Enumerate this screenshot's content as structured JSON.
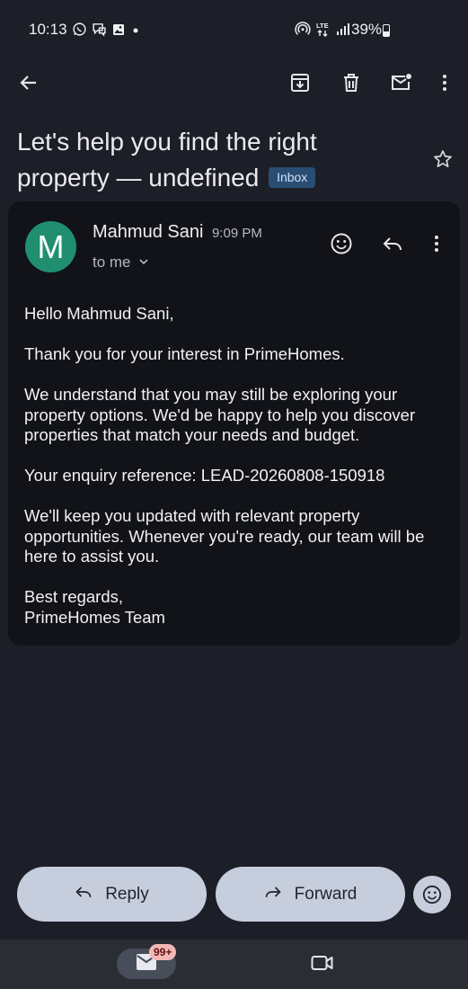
{
  "status_bar": {
    "time": "10:13",
    "battery": "39%",
    "left_icons": [
      "whatsapp-icon",
      "messenger-icon",
      "gallery-icon",
      "dot-icon"
    ],
    "right_icons": [
      "hotspot-icon",
      "lte-icon",
      "signal-icon",
      "battery-icon"
    ]
  },
  "toolbar": {
    "icons": [
      "back-arrow-icon",
      "archive-icon",
      "delete-icon",
      "mark-unread-icon",
      "more-vert-icon"
    ]
  },
  "email": {
    "subject": "Let's help you find the right property — undefined",
    "label_chip": "Inbox",
    "sender_initial": "M",
    "sender_name": "Mahmud Sani",
    "sent_time": "9:09 PM",
    "recipient": "to me",
    "body": [
      "Hello Mahmud Sani,",
      "Thank you for your interest in PrimeHomes.",
      "We understand that you may still be exploring your property options. We'd be happy to help you discover properties that match your needs and budget.",
      "Your enquiry reference: LEAD-20260808-150918",
      "We'll keep you updated with relevant property opportunities. Whenever you're ready, our team will be here to assist you.",
      "Best regards,",
      "PrimeHomes Team"
    ]
  },
  "actions": {
    "reply": "Reply",
    "forward": "Forward"
  },
  "bottom_nav": {
    "mail_badge": "99+"
  },
  "colors": {
    "background": "#1c1f27",
    "card": "#111318",
    "avatar": "#1f8f70",
    "pill": "#c6cede",
    "inbox_chip": "#2a4d74",
    "badge": "#f2b8b5"
  }
}
